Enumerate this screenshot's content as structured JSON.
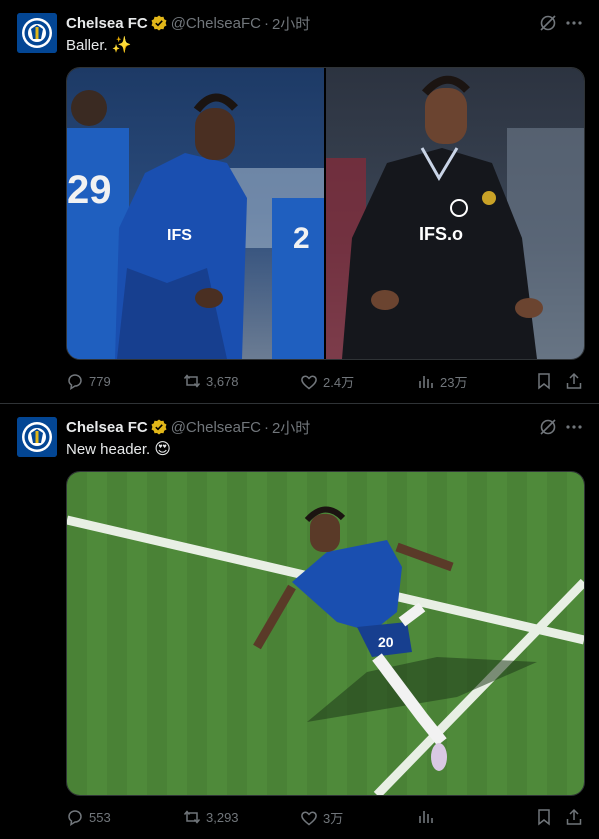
{
  "tweets": [
    {
      "author": "Chelsea FC",
      "handle": "@ChelseaFC",
      "separator": "·",
      "time": "2小时",
      "text": "Baller.",
      "emoji": "✨",
      "photos": [
        "left-photo-celebration-blue-kit",
        "right-photo-celebration-black-kit"
      ],
      "actions": {
        "replies": "779",
        "retweets": "3,678",
        "likes": "2.4万",
        "views": "23万"
      }
    },
    {
      "author": "Chelsea FC",
      "handle": "@ChelseaFC",
      "separator": "·",
      "time": "2小时",
      "text": "New header.",
      "emoji": "😍",
      "photos": [
        "pitch-celebration-aerial"
      ],
      "actions": {
        "replies": "553",
        "retweets": "3,293",
        "likes": "3万",
        "views": ""
      }
    }
  ],
  "colors": {
    "background": "#000000",
    "text": "#e7e9ea",
    "muted": "#71767b",
    "border": "#2f3336",
    "chelsea_blue": "#034694",
    "verified_gold": "#e2b719",
    "pitch_green": "#4f8a3a"
  },
  "icons": [
    "chelsea-crest-icon",
    "verified-badge-icon",
    "grok-icon",
    "more-icon",
    "reply-icon",
    "retweet-icon",
    "like-icon",
    "views-icon",
    "bookmark-icon",
    "share-icon"
  ]
}
